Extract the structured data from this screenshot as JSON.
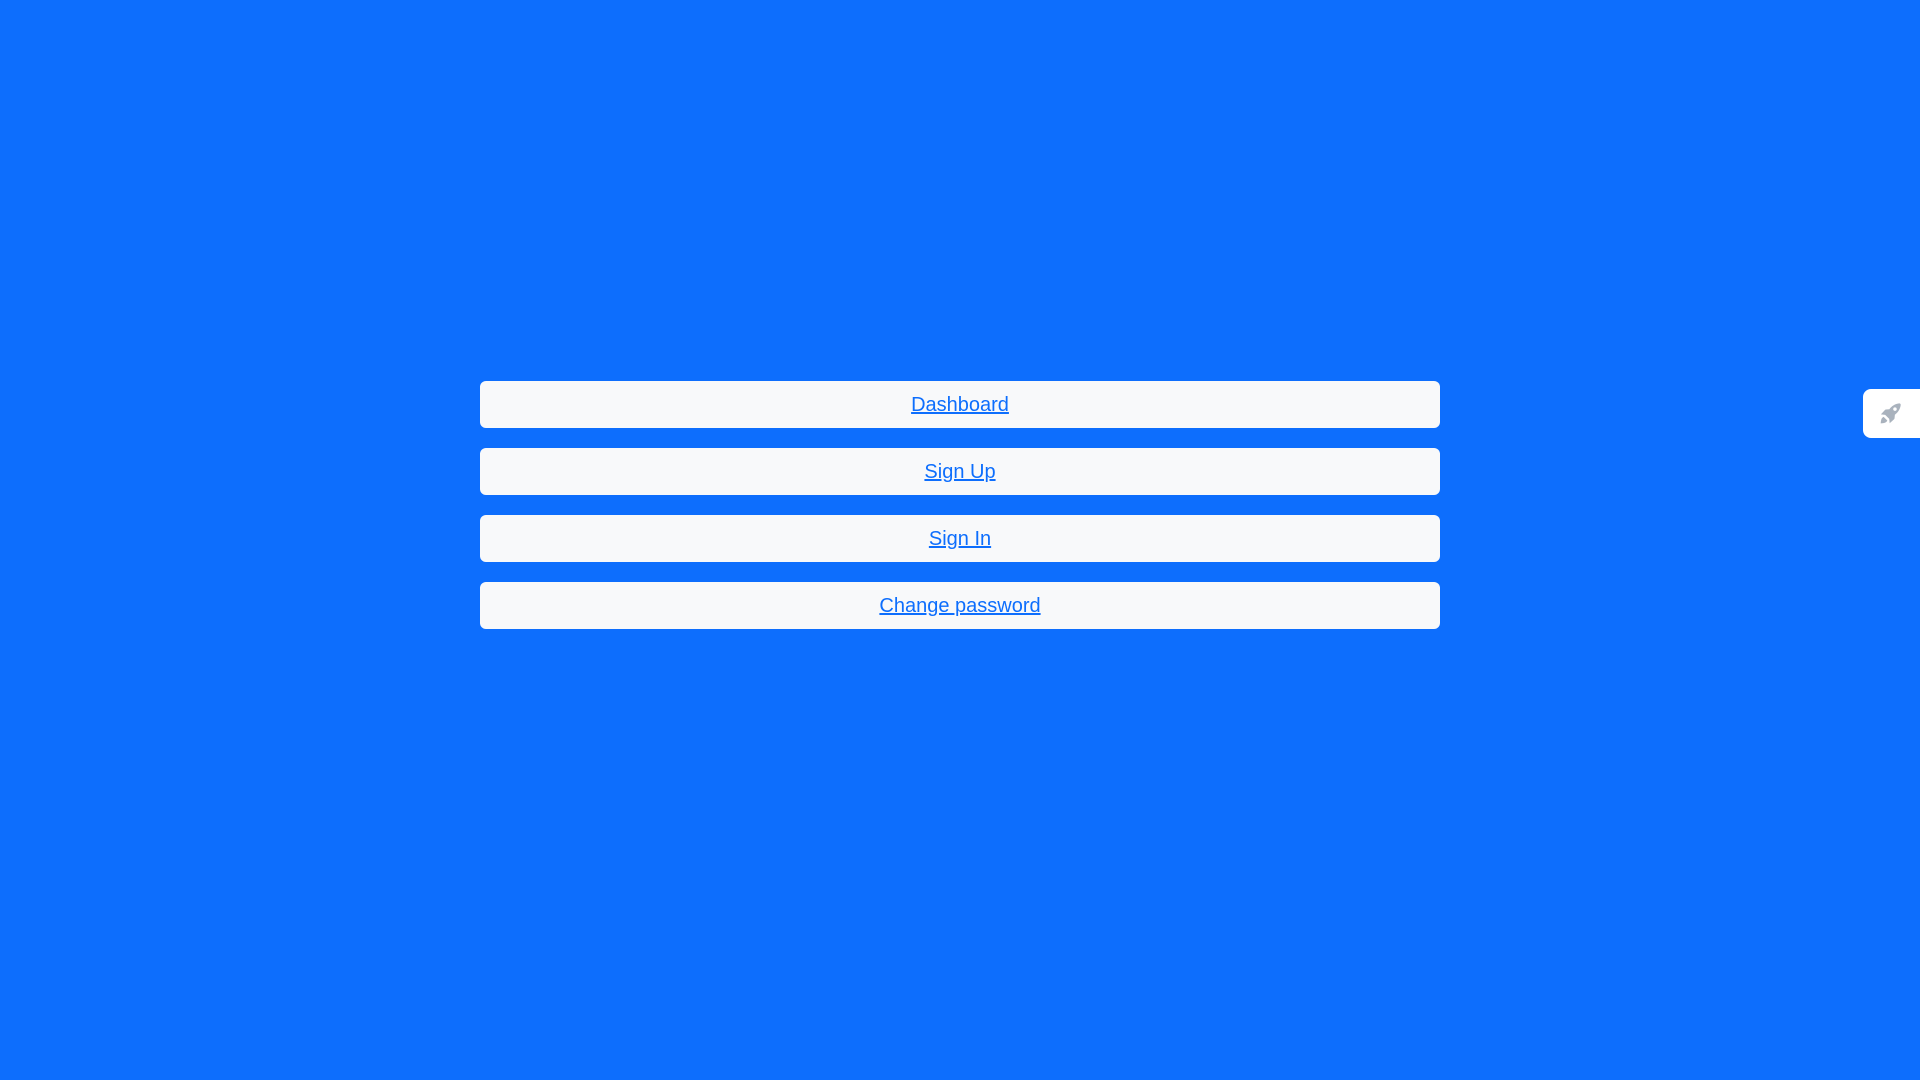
{
  "page": {
    "background_color": "#0d6efd"
  },
  "nav": {
    "items": [
      {
        "label": "Dashboard"
      },
      {
        "label": "Sign Up"
      },
      {
        "label": "Sign In"
      },
      {
        "label": "Change password"
      }
    ],
    "card_color": "#f8f9fa",
    "link_color": "#0d6efd"
  },
  "side_widget": {
    "icon": "rocket-icon",
    "background_color": "#ffffff",
    "icon_color": "#a9b2bd"
  }
}
